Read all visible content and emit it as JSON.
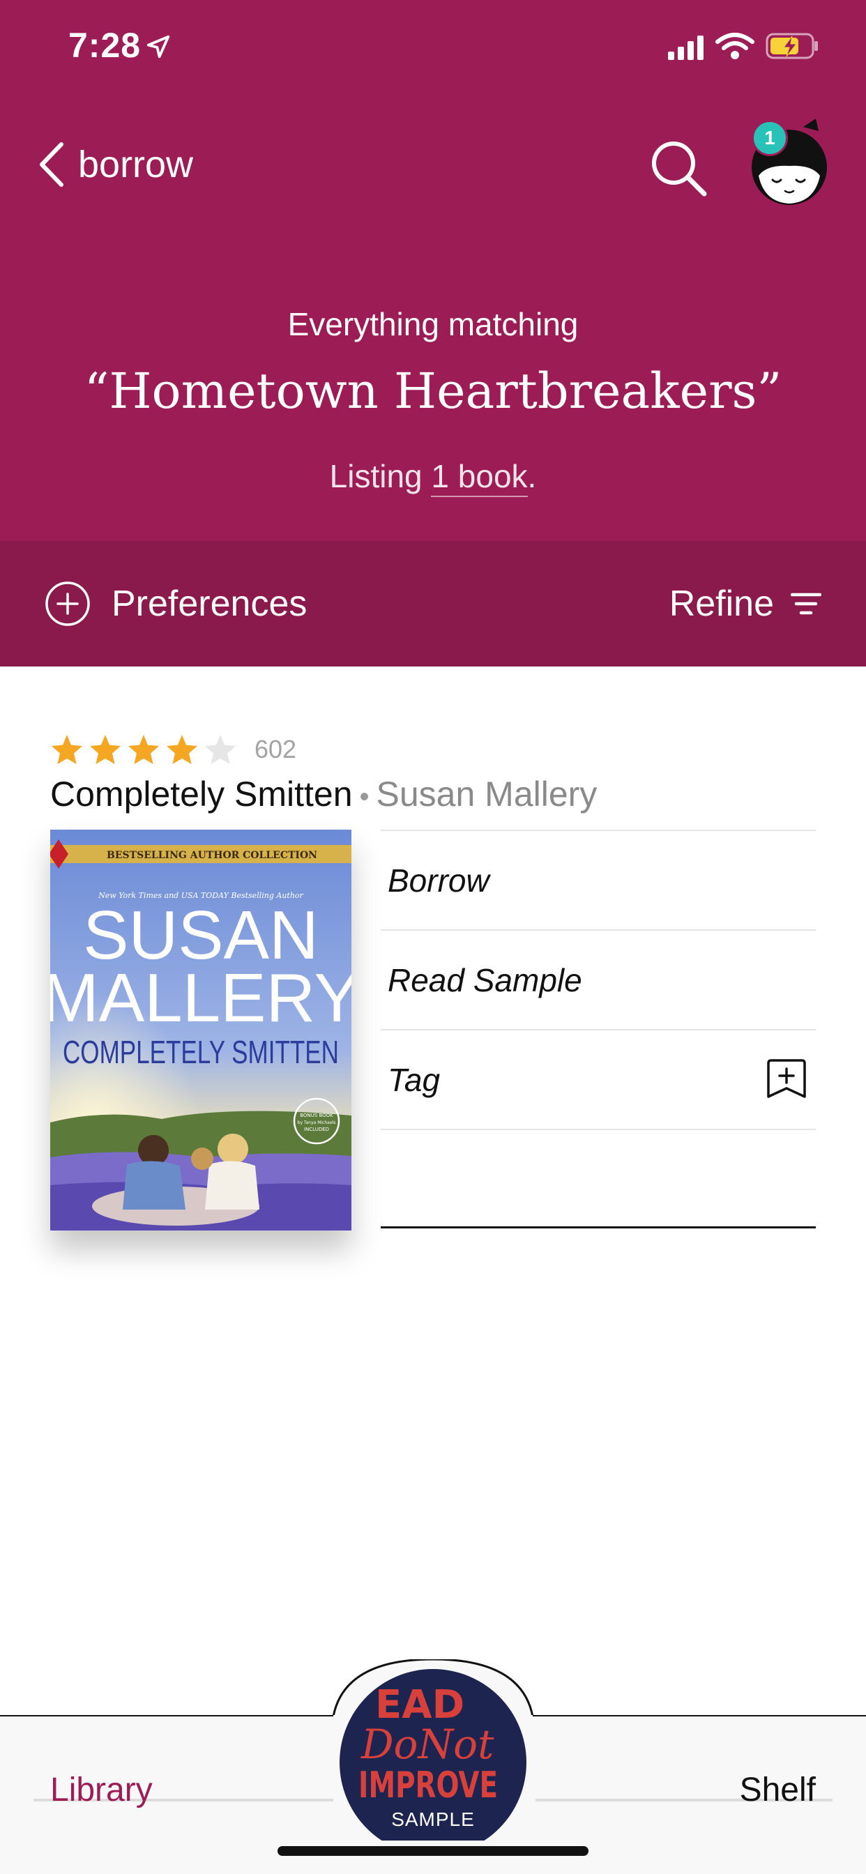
{
  "status_bar": {
    "time": "7:28"
  },
  "header": {
    "back_label": "borrow",
    "avatar_badge": "1",
    "caption": "Everything matching",
    "query": "“Hometown Heartbreakers”",
    "listing_prefix": "Listing ",
    "listing_count": "1 book",
    "listing_suffix": "."
  },
  "toolbar": {
    "preferences_label": "Preferences",
    "refine_label": "Refine"
  },
  "book": {
    "rating": 4,
    "rating_max": 5,
    "rating_count": "602",
    "title": "Completely Smitten",
    "separator": "•",
    "author": "Susan Mallery",
    "cover": {
      "banner": "BESTSELLING AUTHOR COLLECTION",
      "tagline": "New York Times and USA TODAY Bestselling Author",
      "author_line1": "SUSAN",
      "author_line2": "MALLERY",
      "title": "COMPLETELY SMITTEN",
      "seal_line1": "BONUS BOOK",
      "seal_line2": "by Tanya Michaels",
      "seal_line3": "INCLUDED"
    },
    "actions": [
      "Borrow",
      "Read Sample",
      "Tag"
    ]
  },
  "bottom_nav": {
    "library_label": "Library",
    "shelf_label": "Shelf",
    "sample_label": "SAMPLE",
    "sample_art_text": [
      "EAD",
      "DoNot",
      "IMPROVE"
    ]
  },
  "colors": {
    "header": "#9c1c55",
    "toolbar": "#8b1a4c",
    "star": "#f5a623",
    "badge": "#28c2b9",
    "library_accent": "#9c1c55"
  }
}
